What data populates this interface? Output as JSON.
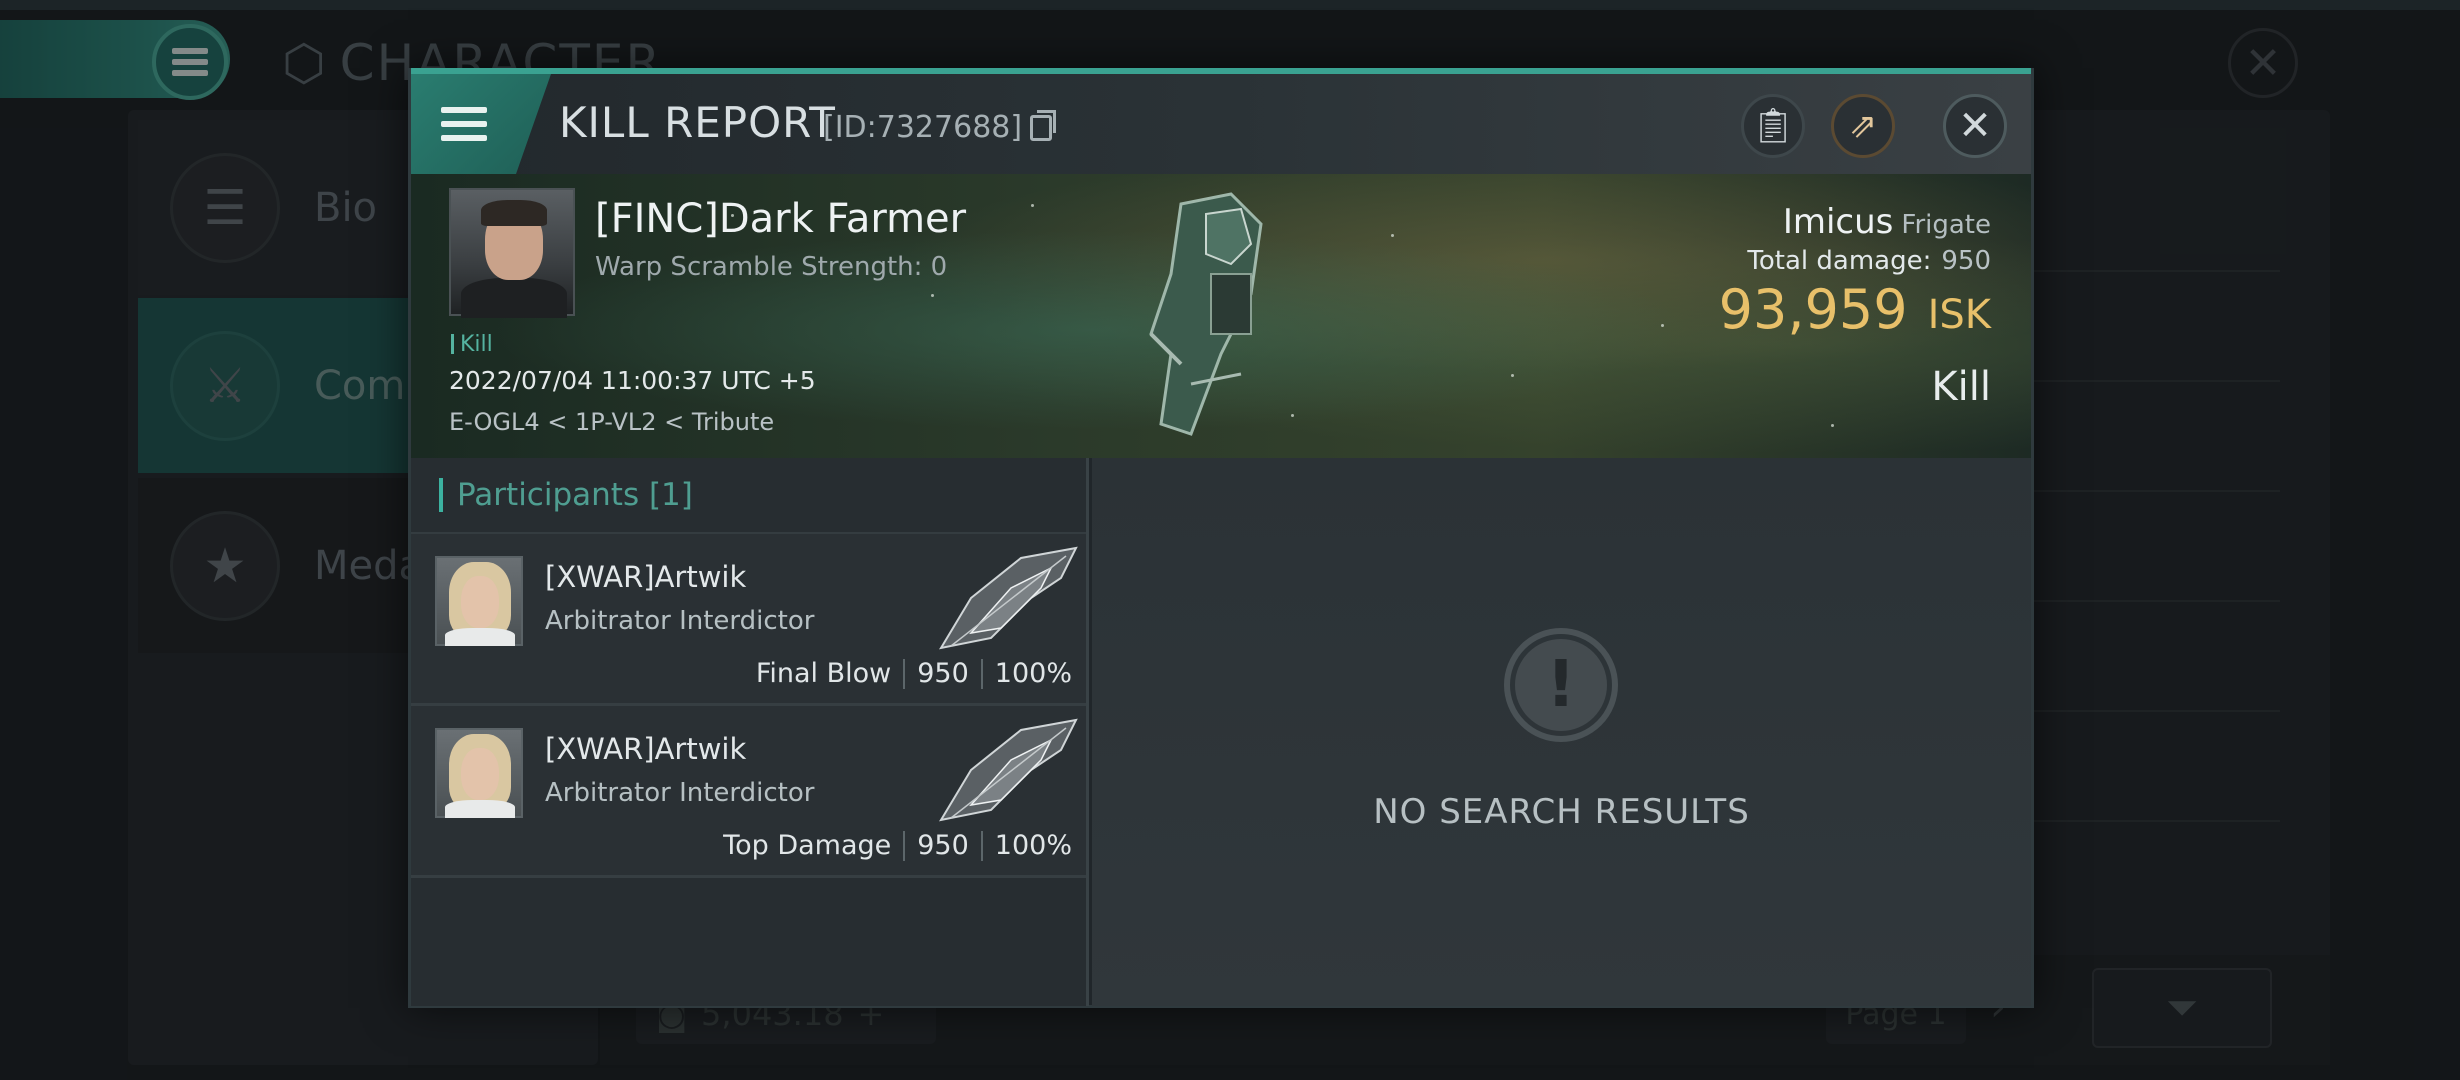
{
  "background": {
    "title": "CHARACTER",
    "tabs": [
      {
        "label": "Bio",
        "icon": "list-icon"
      },
      {
        "label": "Combat",
        "icon": "crossed-swords-icon"
      },
      {
        "label": "Medal",
        "icon": "star-hexagon-icon"
      }
    ],
    "bottom_value": "5,043.18",
    "page_label": "Page 1"
  },
  "modal": {
    "title": "KILL REPORT",
    "id_label": "[ID:7327688]",
    "victim": {
      "name": "[FINC]Dark Farmer",
      "warp_scramble": "Warp Scramble Strength: 0",
      "tag": "Kill",
      "datetime": "2022/07/04 11:00:37 UTC +5",
      "location": "E-OGL4 < 1P-VL2 < Tribute",
      "ship_name": "Imicus",
      "ship_class": "Frigate",
      "total_damage_label": "Total damage:",
      "total_damage": "950",
      "isk_value": "93,959",
      "isk_unit": "ISK",
      "kill_type": "Kill"
    },
    "participants": {
      "header": "Participants [1]",
      "rows": [
        {
          "name": "[XWAR]Artwik",
          "ship": "Arbitrator Interdictor",
          "role": "Final Blow",
          "damage": "950",
          "percent": "100%"
        },
        {
          "name": "[XWAR]Artwik",
          "ship": "Arbitrator Interdictor",
          "role": "Top Damage",
          "damage": "950",
          "percent": "100%"
        }
      ]
    },
    "results": {
      "message": "NO SEARCH RESULTS"
    }
  },
  "colors": {
    "accent": "#3aa291",
    "isk": "#e8c06a"
  }
}
